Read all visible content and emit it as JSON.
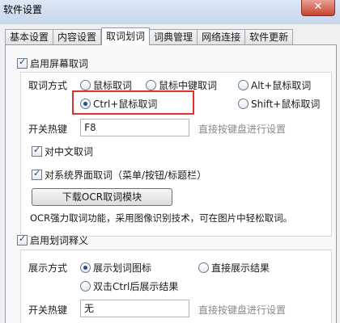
{
  "window": {
    "title": "软件设置",
    "close_label": "✕"
  },
  "tabs": [
    {
      "label": "基本设置"
    },
    {
      "label": "内容设置"
    },
    {
      "label": "取词划词",
      "active": true
    },
    {
      "label": "词典管理"
    },
    {
      "label": "网络连接"
    },
    {
      "label": "软件更新"
    }
  ],
  "capture": {
    "enable_label": "启用屏幕取词",
    "enabled": true,
    "mode_label": "取词方式",
    "modes": [
      {
        "label": "鼠标取词",
        "checked": false
      },
      {
        "label": "鼠标中键取词",
        "checked": false
      },
      {
        "label": "Alt+鼠标取词",
        "checked": false
      },
      {
        "label": "Ctrl+鼠标取词",
        "checked": true
      },
      {
        "label": "Shift+鼠标取词",
        "checked": false
      }
    ],
    "hotkey_label": "开关热键",
    "hotkey_value": "F8",
    "hotkey_hint": "直接按键盘进行设置",
    "chinese_label": "对中文取词",
    "chinese_checked": true,
    "system_ui_label": "对系统界面取词（菜单/按钮/标题栏）",
    "system_ui_checked": true,
    "ocr_button_label": "下载OCR取词模块",
    "ocr_note": "OCR强力取词功能，采用图像识别技术，可在图片中轻松取词。"
  },
  "selection": {
    "enable_label": "启用划词释义",
    "enabled": true,
    "display_label": "展示方式",
    "displays": [
      {
        "label": "展示划词图标",
        "checked": true
      },
      {
        "label": "直接展示结果",
        "checked": false
      },
      {
        "label": "双击Ctrl后展示结果",
        "checked": false
      }
    ],
    "hotkey_label": "开关热键",
    "hotkey_value": "无",
    "hotkey_hint": "直接按键盘进行设置"
  },
  "colors": {
    "highlight": "#e0322b",
    "titlebar": "#cfdcec",
    "close": "#c7452f"
  }
}
